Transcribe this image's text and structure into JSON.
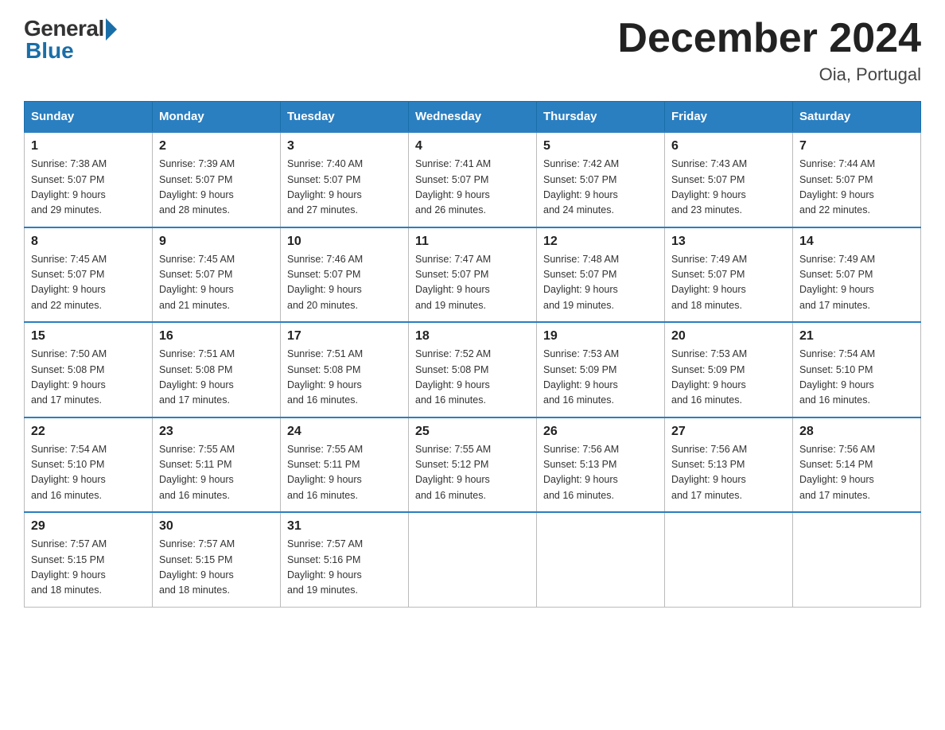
{
  "header": {
    "logo_general": "General",
    "logo_blue": "Blue",
    "title": "December 2024",
    "location": "Oia, Portugal"
  },
  "weekdays": [
    "Sunday",
    "Monday",
    "Tuesday",
    "Wednesday",
    "Thursday",
    "Friday",
    "Saturday"
  ],
  "weeks": [
    [
      {
        "day": "1",
        "sunrise": "7:38 AM",
        "sunset": "5:07 PM",
        "daylight": "9 hours and 29 minutes."
      },
      {
        "day": "2",
        "sunrise": "7:39 AM",
        "sunset": "5:07 PM",
        "daylight": "9 hours and 28 minutes."
      },
      {
        "day": "3",
        "sunrise": "7:40 AM",
        "sunset": "5:07 PM",
        "daylight": "9 hours and 27 minutes."
      },
      {
        "day": "4",
        "sunrise": "7:41 AM",
        "sunset": "5:07 PM",
        "daylight": "9 hours and 26 minutes."
      },
      {
        "day": "5",
        "sunrise": "7:42 AM",
        "sunset": "5:07 PM",
        "daylight": "9 hours and 24 minutes."
      },
      {
        "day": "6",
        "sunrise": "7:43 AM",
        "sunset": "5:07 PM",
        "daylight": "9 hours and 23 minutes."
      },
      {
        "day": "7",
        "sunrise": "7:44 AM",
        "sunset": "5:07 PM",
        "daylight": "9 hours and 22 minutes."
      }
    ],
    [
      {
        "day": "8",
        "sunrise": "7:45 AM",
        "sunset": "5:07 PM",
        "daylight": "9 hours and 22 minutes."
      },
      {
        "day": "9",
        "sunrise": "7:45 AM",
        "sunset": "5:07 PM",
        "daylight": "9 hours and 21 minutes."
      },
      {
        "day": "10",
        "sunrise": "7:46 AM",
        "sunset": "5:07 PM",
        "daylight": "9 hours and 20 minutes."
      },
      {
        "day": "11",
        "sunrise": "7:47 AM",
        "sunset": "5:07 PM",
        "daylight": "9 hours and 19 minutes."
      },
      {
        "day": "12",
        "sunrise": "7:48 AM",
        "sunset": "5:07 PM",
        "daylight": "9 hours and 19 minutes."
      },
      {
        "day": "13",
        "sunrise": "7:49 AM",
        "sunset": "5:07 PM",
        "daylight": "9 hours and 18 minutes."
      },
      {
        "day": "14",
        "sunrise": "7:49 AM",
        "sunset": "5:07 PM",
        "daylight": "9 hours and 17 minutes."
      }
    ],
    [
      {
        "day": "15",
        "sunrise": "7:50 AM",
        "sunset": "5:08 PM",
        "daylight": "9 hours and 17 minutes."
      },
      {
        "day": "16",
        "sunrise": "7:51 AM",
        "sunset": "5:08 PM",
        "daylight": "9 hours and 17 minutes."
      },
      {
        "day": "17",
        "sunrise": "7:51 AM",
        "sunset": "5:08 PM",
        "daylight": "9 hours and 16 minutes."
      },
      {
        "day": "18",
        "sunrise": "7:52 AM",
        "sunset": "5:08 PM",
        "daylight": "9 hours and 16 minutes."
      },
      {
        "day": "19",
        "sunrise": "7:53 AM",
        "sunset": "5:09 PM",
        "daylight": "9 hours and 16 minutes."
      },
      {
        "day": "20",
        "sunrise": "7:53 AM",
        "sunset": "5:09 PM",
        "daylight": "9 hours and 16 minutes."
      },
      {
        "day": "21",
        "sunrise": "7:54 AM",
        "sunset": "5:10 PM",
        "daylight": "9 hours and 16 minutes."
      }
    ],
    [
      {
        "day": "22",
        "sunrise": "7:54 AM",
        "sunset": "5:10 PM",
        "daylight": "9 hours and 16 minutes."
      },
      {
        "day": "23",
        "sunrise": "7:55 AM",
        "sunset": "5:11 PM",
        "daylight": "9 hours and 16 minutes."
      },
      {
        "day": "24",
        "sunrise": "7:55 AM",
        "sunset": "5:11 PM",
        "daylight": "9 hours and 16 minutes."
      },
      {
        "day": "25",
        "sunrise": "7:55 AM",
        "sunset": "5:12 PM",
        "daylight": "9 hours and 16 minutes."
      },
      {
        "day": "26",
        "sunrise": "7:56 AM",
        "sunset": "5:13 PM",
        "daylight": "9 hours and 16 minutes."
      },
      {
        "day": "27",
        "sunrise": "7:56 AM",
        "sunset": "5:13 PM",
        "daylight": "9 hours and 17 minutes."
      },
      {
        "day": "28",
        "sunrise": "7:56 AM",
        "sunset": "5:14 PM",
        "daylight": "9 hours and 17 minutes."
      }
    ],
    [
      {
        "day": "29",
        "sunrise": "7:57 AM",
        "sunset": "5:15 PM",
        "daylight": "9 hours and 18 minutes."
      },
      {
        "day": "30",
        "sunrise": "7:57 AM",
        "sunset": "5:15 PM",
        "daylight": "9 hours and 18 minutes."
      },
      {
        "day": "31",
        "sunrise": "7:57 AM",
        "sunset": "5:16 PM",
        "daylight": "9 hours and 19 minutes."
      },
      null,
      null,
      null,
      null
    ]
  ],
  "labels": {
    "sunrise_prefix": "Sunrise: ",
    "sunset_prefix": "Sunset: ",
    "daylight_prefix": "Daylight: "
  }
}
